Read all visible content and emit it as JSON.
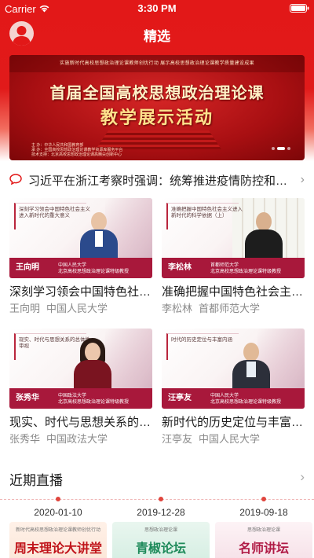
{
  "status": {
    "carrier": "Carrier",
    "time": "3:30 PM"
  },
  "nav": {
    "title": "精选",
    "avatar_icon": "user-avatar-icon"
  },
  "banner": {
    "subtitle": "实施新时代高校思想政治理论课教师创优行动  展示高校思想政治理论课教学质量建设成果",
    "title_line1": "首届全国高校思想政治理论课",
    "title_line2": "教学展示活动",
    "footer_line1": "主    办：中华人民共和国教育部",
    "footer_line2": "承    办：全国高校思想政治理论课教学资源库服务平台",
    "footer_line3": "技术支持：北京高校思想政治理论课高精尖创新中心"
  },
  "news": {
    "icon": "chat-bubble-icon",
    "text": "习近平在浙江考察时强调：统筹推进疫情防控和经济社会发展工作"
  },
  "courses": [
    {
      "title": "深刻学习领会中国特色社会主义",
      "teacher": "王向明",
      "school": "中国人民大学",
      "thumb_caption": "深刻学习领会中国特色社会主义进入新时代的重大意义",
      "thumb_name": "王向明",
      "thumb_inst": "中国人民大学\n北京高校思想政治理论课特级教授"
    },
    {
      "title": "准确把握中国特色社会主义进入新时代",
      "teacher": "李松林",
      "school": "首都师范大学",
      "thumb_caption": "准确把握中国特色社会主义进入新时代的科学依据（上）",
      "thumb_name": "李松林",
      "thumb_inst": "首都师范大学\n北京高校思想政治理论课特级教授"
    },
    {
      "title": "现实、时代与思想关系的总体性审视",
      "teacher": "张秀华",
      "school": "中国政法大学",
      "thumb_caption": "现实、时代与思想关系的总体性审视",
      "thumb_name": "张秀华",
      "thumb_inst": "中国政法大学\n北京高校思想政治理论课特级教授"
    },
    {
      "title": "新时代的历史定位与丰富内涵",
      "teacher": "汪亭友",
      "school": "中国人民大学",
      "thumb_caption": "时代的历史定位与丰富内涵",
      "thumb_name": "汪亭友",
      "thumb_inst": "中国人民大学\n北京高校思想政治理论课特级教授"
    }
  ],
  "live": {
    "title": "近期直播",
    "items": [
      {
        "date": "2020-01-10",
        "headline": "周末理论大讲堂",
        "small": "新时代高校思想政治理论课教师创优行动"
      },
      {
        "date": "2019-12-28",
        "headline": "青椒论坛",
        "small": "思想政治理论课"
      },
      {
        "date": "2019-09-18",
        "headline": "名师讲坛",
        "small": "思想政治理论课"
      }
    ]
  },
  "colors": {
    "primary_red": "#e21818",
    "thumb_bar": "#a8183b",
    "meta_gray": "#8a8a8a"
  }
}
